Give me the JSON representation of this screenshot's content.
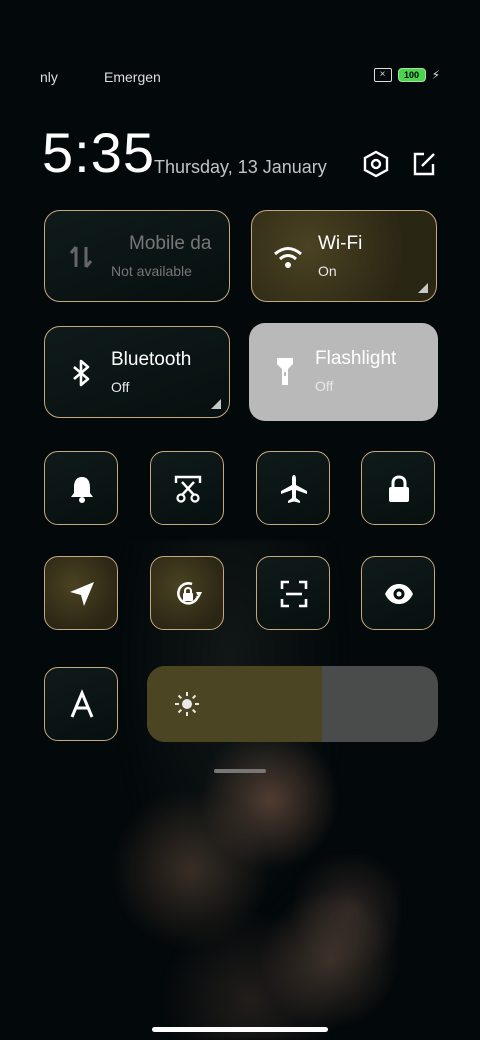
{
  "status_bar": {
    "left_text_1": "nly",
    "left_text_2": "Emergen",
    "battery_level": "100",
    "sim_icon": "no-sim-icon",
    "charging_icon": "bolt-icon"
  },
  "header": {
    "time": "5:35",
    "date": "Thursday, 13 January",
    "settings_icon": "settings-hex-icon",
    "edit_icon": "edit-icon"
  },
  "tiles": [
    {
      "name": "mobile-data",
      "title": "Mobile da",
      "subtitle": "Not available",
      "icon": "mobile-data-icon",
      "state": "unavailable"
    },
    {
      "name": "wifi",
      "title": "Wi-Fi",
      "subtitle": "On",
      "icon": "wifi-icon",
      "state": "on"
    },
    {
      "name": "bluetooth",
      "title": "Bluetooth",
      "subtitle": "Off",
      "icon": "bluetooth-icon",
      "state": "off"
    },
    {
      "name": "flashlight",
      "title": "Flashlight",
      "subtitle": "Off",
      "icon": "flashlight-icon",
      "state": "off"
    }
  ],
  "toggles_row1": [
    "bell-icon",
    "screenshot-scissors-icon",
    "airplane-icon",
    "lock-icon"
  ],
  "toggles_row2": [
    "location-icon",
    "rotation-lock-icon",
    "scan-icon",
    "eye-icon"
  ],
  "auto_font_icon": "font-a-icon",
  "brightness": {
    "level": 0.6,
    "icon": "sun-icon"
  },
  "colors": {
    "accent_border": "#c7a77f",
    "active_tile": "#4a4222",
    "flashlight_tile": "#b9b9b9"
  }
}
